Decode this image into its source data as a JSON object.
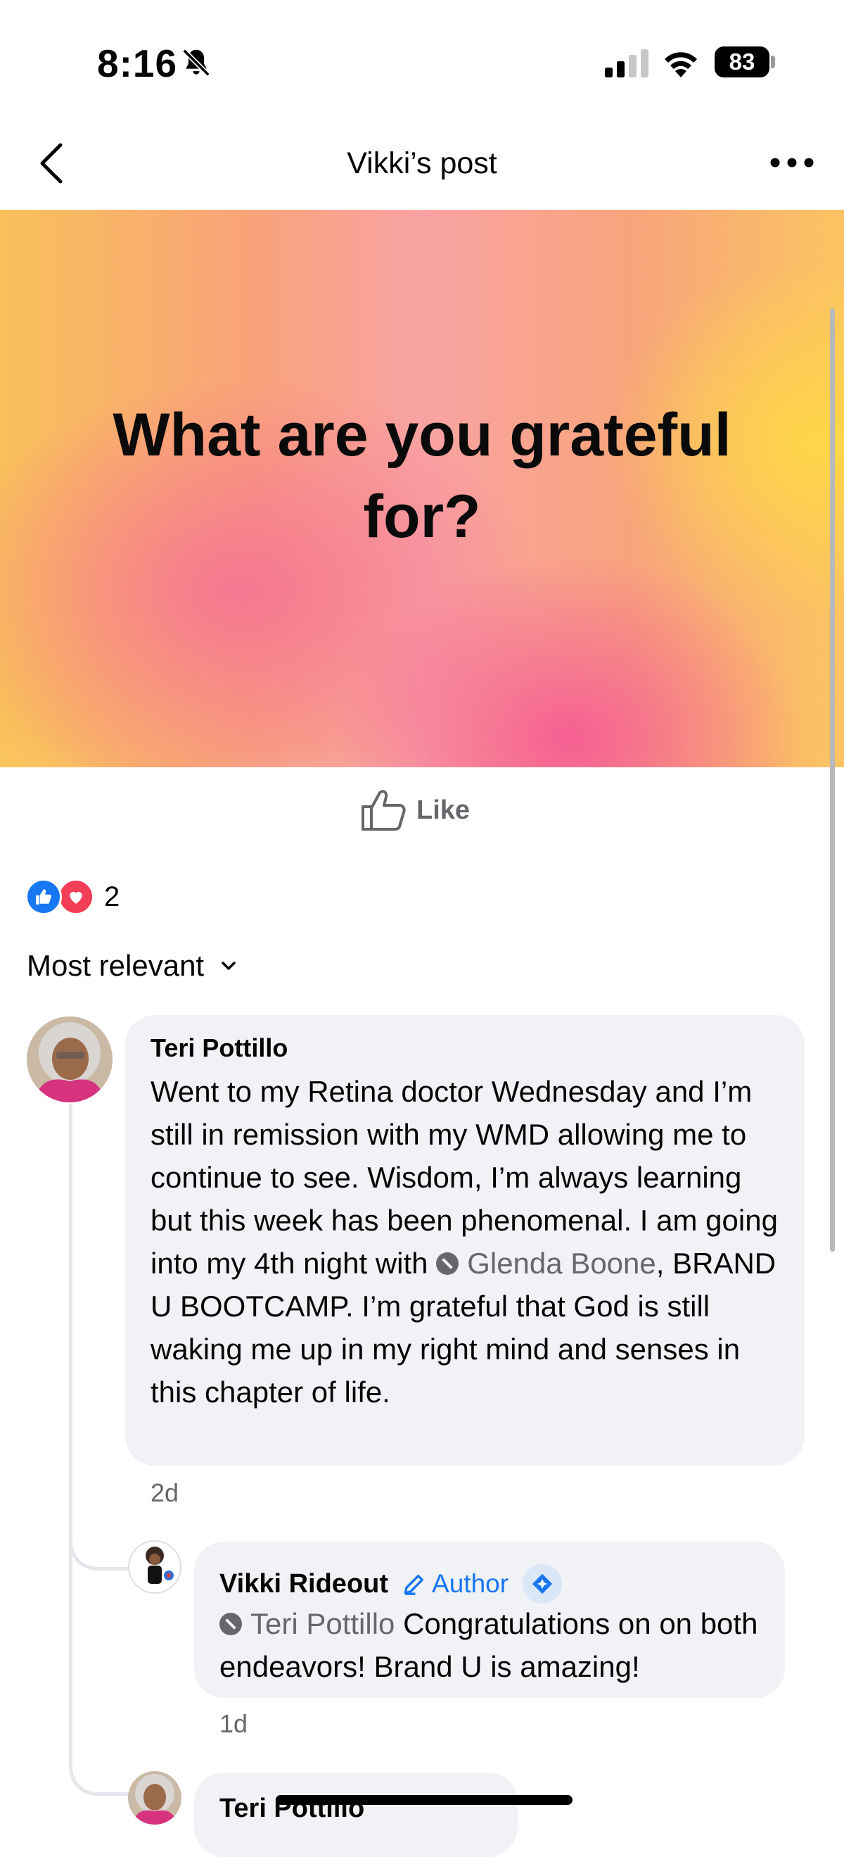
{
  "status_bar": {
    "time": "8:16",
    "battery": "83"
  },
  "header": {
    "title": "Vikki’s post"
  },
  "post": {
    "text": "What are you grateful for?"
  },
  "actions": {
    "like_label": "Like"
  },
  "reactions": {
    "count": "2"
  },
  "sort": {
    "label": "Most relevant"
  },
  "comments": [
    {
      "author": "Teri Pottillo",
      "text_before_mention": "Went to my Retina doctor Wednesday and I’m still in remission with my WMD allowing me to continue to see. Wisdom, I’m always learning but this week has been phenomenal. I am going into my 4th night with ",
      "mention": "Glenda Boone",
      "text_after_mention": ", BRAND U BOOTCAMP. I’m grateful that God is still waking me up in my right mind and senses in this chapter of life.",
      "time": "2d"
    },
    {
      "author": "Vikki Rideout",
      "badge": "Author",
      "mention": "Teri Pottillo",
      "text_after_mention": " Congratulations on on both endeavors! Brand U is amazing!",
      "time": "1d"
    },
    {
      "author": "Teri Pottillo"
    }
  ],
  "colors": {
    "accent": "#1877f2",
    "love": "#f33e58",
    "bubble": "#f0f2f5",
    "muted": "#65676b"
  }
}
